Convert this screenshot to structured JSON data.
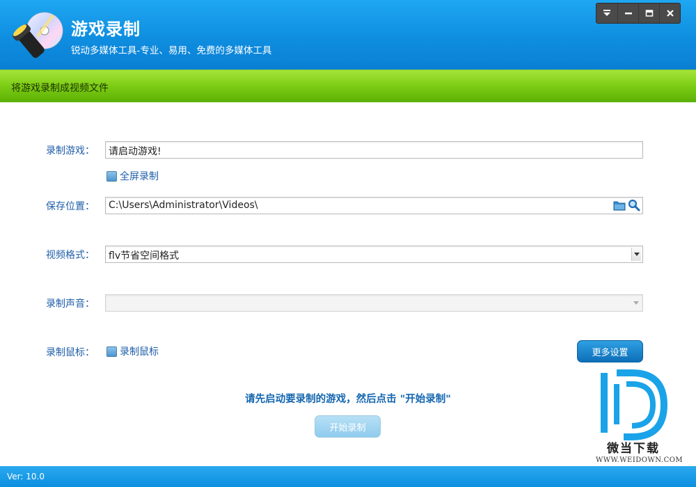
{
  "app": {
    "title": "游戏录制",
    "subtitle": "锐动多媒体工具-专业、易用、免费的多媒体工具"
  },
  "window_controls": [
    "menu-icon",
    "minimize-icon",
    "maximize-icon",
    "close-icon"
  ],
  "section": {
    "title": "将游戏录制成视频文件"
  },
  "form": {
    "game": {
      "label": "录制游戏：",
      "value": "请启动游戏!"
    },
    "fullscreen": {
      "label": "全屏录制",
      "checked": false
    },
    "save_location": {
      "label": "保存位置：",
      "value": "C:\\Users\\Administrator\\Videos\\"
    },
    "video_format": {
      "label": "视频格式：",
      "value": "flv节省空间格式"
    },
    "audio": {
      "label": "录制声音：",
      "value": ""
    },
    "mouse": {
      "label": "录制鼠标：",
      "checkbox_label": "录制鼠标",
      "checked": false
    },
    "more_settings": "更多设置"
  },
  "hint": "请先启动要录制的游戏，然后点击 \"开始录制\"",
  "start_button": "开始录制",
  "watermark": {
    "text": "微当下载",
    "url": "WWW.WEIDOWN.COM"
  },
  "status": {
    "version": "Ver: 10.0"
  },
  "colors": {
    "header": "#0f8ee0",
    "section_bar": "#7ccc14",
    "label": "#1f5ea8",
    "status_bar": "#0d8fe0"
  }
}
